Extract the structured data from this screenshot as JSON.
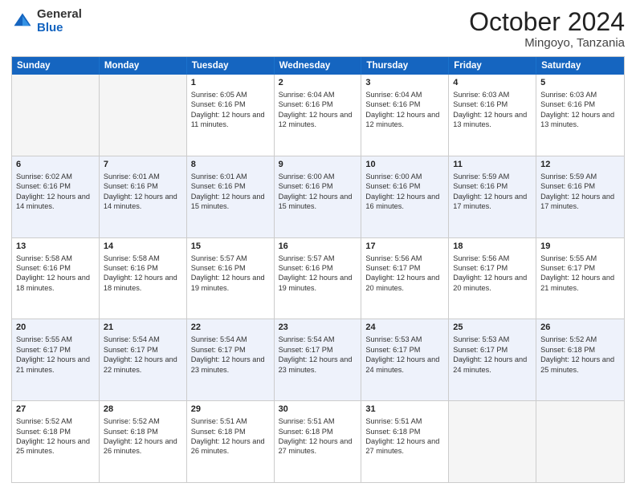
{
  "header": {
    "logo_general": "General",
    "logo_blue": "Blue",
    "month": "October 2024",
    "location": "Mingoyo, Tanzania"
  },
  "days_of_week": [
    "Sunday",
    "Monday",
    "Tuesday",
    "Wednesday",
    "Thursday",
    "Friday",
    "Saturday"
  ],
  "weeks": [
    [
      {
        "day": "",
        "sunrise": "",
        "sunset": "",
        "daylight": ""
      },
      {
        "day": "",
        "sunrise": "",
        "sunset": "",
        "daylight": ""
      },
      {
        "day": "1",
        "sunrise": "Sunrise: 6:05 AM",
        "sunset": "Sunset: 6:16 PM",
        "daylight": "Daylight: 12 hours and 11 minutes."
      },
      {
        "day": "2",
        "sunrise": "Sunrise: 6:04 AM",
        "sunset": "Sunset: 6:16 PM",
        "daylight": "Daylight: 12 hours and 12 minutes."
      },
      {
        "day": "3",
        "sunrise": "Sunrise: 6:04 AM",
        "sunset": "Sunset: 6:16 PM",
        "daylight": "Daylight: 12 hours and 12 minutes."
      },
      {
        "day": "4",
        "sunrise": "Sunrise: 6:03 AM",
        "sunset": "Sunset: 6:16 PM",
        "daylight": "Daylight: 12 hours and 13 minutes."
      },
      {
        "day": "5",
        "sunrise": "Sunrise: 6:03 AM",
        "sunset": "Sunset: 6:16 PM",
        "daylight": "Daylight: 12 hours and 13 minutes."
      }
    ],
    [
      {
        "day": "6",
        "sunrise": "Sunrise: 6:02 AM",
        "sunset": "Sunset: 6:16 PM",
        "daylight": "Daylight: 12 hours and 14 minutes."
      },
      {
        "day": "7",
        "sunrise": "Sunrise: 6:01 AM",
        "sunset": "Sunset: 6:16 PM",
        "daylight": "Daylight: 12 hours and 14 minutes."
      },
      {
        "day": "8",
        "sunrise": "Sunrise: 6:01 AM",
        "sunset": "Sunset: 6:16 PM",
        "daylight": "Daylight: 12 hours and 15 minutes."
      },
      {
        "day": "9",
        "sunrise": "Sunrise: 6:00 AM",
        "sunset": "Sunset: 6:16 PM",
        "daylight": "Daylight: 12 hours and 15 minutes."
      },
      {
        "day": "10",
        "sunrise": "Sunrise: 6:00 AM",
        "sunset": "Sunset: 6:16 PM",
        "daylight": "Daylight: 12 hours and 16 minutes."
      },
      {
        "day": "11",
        "sunrise": "Sunrise: 5:59 AM",
        "sunset": "Sunset: 6:16 PM",
        "daylight": "Daylight: 12 hours and 17 minutes."
      },
      {
        "day": "12",
        "sunrise": "Sunrise: 5:59 AM",
        "sunset": "Sunset: 6:16 PM",
        "daylight": "Daylight: 12 hours and 17 minutes."
      }
    ],
    [
      {
        "day": "13",
        "sunrise": "Sunrise: 5:58 AM",
        "sunset": "Sunset: 6:16 PM",
        "daylight": "Daylight: 12 hours and 18 minutes."
      },
      {
        "day": "14",
        "sunrise": "Sunrise: 5:58 AM",
        "sunset": "Sunset: 6:16 PM",
        "daylight": "Daylight: 12 hours and 18 minutes."
      },
      {
        "day": "15",
        "sunrise": "Sunrise: 5:57 AM",
        "sunset": "Sunset: 6:16 PM",
        "daylight": "Daylight: 12 hours and 19 minutes."
      },
      {
        "day": "16",
        "sunrise": "Sunrise: 5:57 AM",
        "sunset": "Sunset: 6:16 PM",
        "daylight": "Daylight: 12 hours and 19 minutes."
      },
      {
        "day": "17",
        "sunrise": "Sunrise: 5:56 AM",
        "sunset": "Sunset: 6:17 PM",
        "daylight": "Daylight: 12 hours and 20 minutes."
      },
      {
        "day": "18",
        "sunrise": "Sunrise: 5:56 AM",
        "sunset": "Sunset: 6:17 PM",
        "daylight": "Daylight: 12 hours and 20 minutes."
      },
      {
        "day": "19",
        "sunrise": "Sunrise: 5:55 AM",
        "sunset": "Sunset: 6:17 PM",
        "daylight": "Daylight: 12 hours and 21 minutes."
      }
    ],
    [
      {
        "day": "20",
        "sunrise": "Sunrise: 5:55 AM",
        "sunset": "Sunset: 6:17 PM",
        "daylight": "Daylight: 12 hours and 21 minutes."
      },
      {
        "day": "21",
        "sunrise": "Sunrise: 5:54 AM",
        "sunset": "Sunset: 6:17 PM",
        "daylight": "Daylight: 12 hours and 22 minutes."
      },
      {
        "day": "22",
        "sunrise": "Sunrise: 5:54 AM",
        "sunset": "Sunset: 6:17 PM",
        "daylight": "Daylight: 12 hours and 23 minutes."
      },
      {
        "day": "23",
        "sunrise": "Sunrise: 5:54 AM",
        "sunset": "Sunset: 6:17 PM",
        "daylight": "Daylight: 12 hours and 23 minutes."
      },
      {
        "day": "24",
        "sunrise": "Sunrise: 5:53 AM",
        "sunset": "Sunset: 6:17 PM",
        "daylight": "Daylight: 12 hours and 24 minutes."
      },
      {
        "day": "25",
        "sunrise": "Sunrise: 5:53 AM",
        "sunset": "Sunset: 6:17 PM",
        "daylight": "Daylight: 12 hours and 24 minutes."
      },
      {
        "day": "26",
        "sunrise": "Sunrise: 5:52 AM",
        "sunset": "Sunset: 6:18 PM",
        "daylight": "Daylight: 12 hours and 25 minutes."
      }
    ],
    [
      {
        "day": "27",
        "sunrise": "Sunrise: 5:52 AM",
        "sunset": "Sunset: 6:18 PM",
        "daylight": "Daylight: 12 hours and 25 minutes."
      },
      {
        "day": "28",
        "sunrise": "Sunrise: 5:52 AM",
        "sunset": "Sunset: 6:18 PM",
        "daylight": "Daylight: 12 hours and 26 minutes."
      },
      {
        "day": "29",
        "sunrise": "Sunrise: 5:51 AM",
        "sunset": "Sunset: 6:18 PM",
        "daylight": "Daylight: 12 hours and 26 minutes."
      },
      {
        "day": "30",
        "sunrise": "Sunrise: 5:51 AM",
        "sunset": "Sunset: 6:18 PM",
        "daylight": "Daylight: 12 hours and 27 minutes."
      },
      {
        "day": "31",
        "sunrise": "Sunrise: 5:51 AM",
        "sunset": "Sunset: 6:18 PM",
        "daylight": "Daylight: 12 hours and 27 minutes."
      },
      {
        "day": "",
        "sunrise": "",
        "sunset": "",
        "daylight": ""
      },
      {
        "day": "",
        "sunrise": "",
        "sunset": "",
        "daylight": ""
      }
    ]
  ]
}
